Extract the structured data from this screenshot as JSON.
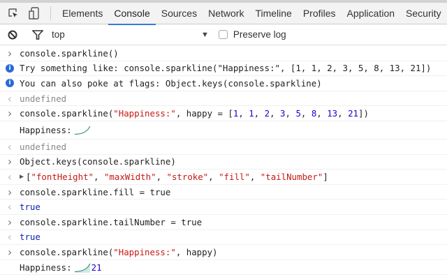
{
  "tabs": [
    {
      "label": "Elements"
    },
    {
      "label": "Console",
      "active": true
    },
    {
      "label": "Sources"
    },
    {
      "label": "Network"
    },
    {
      "label": "Timeline"
    },
    {
      "label": "Profiles"
    },
    {
      "label": "Application"
    },
    {
      "label": "Security"
    }
  ],
  "filter": {
    "context": "top",
    "preserve_log": "Preserve log"
  },
  "colors": {
    "string": "#c41a16",
    "number": "#1c00cf",
    "sparkline": "#3a9a8a",
    "accent": "#3879d9"
  },
  "rows": [
    {
      "kind": "input",
      "segs": [
        {
          "t": "plain",
          "v": "console.sparkline()"
        }
      ]
    },
    {
      "kind": "info",
      "segs": [
        {
          "t": "plain",
          "v": "Try something like: console.sparkline(\"Happiness:\", [1, 1, 2, 3, 5, 8, 13, 21])"
        }
      ]
    },
    {
      "kind": "info",
      "segs": [
        {
          "t": "plain",
          "v": "You can also poke at flags: Object.keys(console.sparkline)"
        }
      ]
    },
    {
      "kind": "result",
      "segs": [
        {
          "t": "gray",
          "v": "undefined"
        }
      ]
    },
    {
      "kind": "input",
      "segs": [
        {
          "t": "plain",
          "v": "console.sparkline("
        },
        {
          "t": "str",
          "v": "\"Happiness:\""
        },
        {
          "t": "plain",
          "v": ", happy = ["
        },
        {
          "t": "num",
          "v": "1"
        },
        {
          "t": "plain",
          "v": ", "
        },
        {
          "t": "num",
          "v": "1"
        },
        {
          "t": "plain",
          "v": ", "
        },
        {
          "t": "num",
          "v": "2"
        },
        {
          "t": "plain",
          "v": ", "
        },
        {
          "t": "num",
          "v": "3"
        },
        {
          "t": "plain",
          "v": ", "
        },
        {
          "t": "num",
          "v": "5"
        },
        {
          "t": "plain",
          "v": ", "
        },
        {
          "t": "num",
          "v": "8"
        },
        {
          "t": "plain",
          "v": ", "
        },
        {
          "t": "num",
          "v": "13"
        },
        {
          "t": "plain",
          "v": ", "
        },
        {
          "t": "num",
          "v": "21"
        },
        {
          "t": "plain",
          "v": "])"
        }
      ]
    },
    {
      "kind": "log",
      "tall": true,
      "segs": [
        {
          "t": "plain",
          "v": "Happiness:"
        }
      ],
      "sparkline": {
        "fill": false,
        "tail": ""
      }
    },
    {
      "kind": "result",
      "segs": [
        {
          "t": "gray",
          "v": "undefined"
        }
      ]
    },
    {
      "kind": "input",
      "segs": [
        {
          "t": "plain",
          "v": "Object.keys(console.sparkline)"
        }
      ]
    },
    {
      "kind": "result",
      "tri": true,
      "segs": [
        {
          "t": "plain",
          "v": "["
        },
        {
          "t": "str",
          "v": "\"fontHeight\""
        },
        {
          "t": "plain",
          "v": ", "
        },
        {
          "t": "str",
          "v": "\"maxWidth\""
        },
        {
          "t": "plain",
          "v": ", "
        },
        {
          "t": "str",
          "v": "\"stroke\""
        },
        {
          "t": "plain",
          "v": ", "
        },
        {
          "t": "str",
          "v": "\"fill\""
        },
        {
          "t": "plain",
          "v": ", "
        },
        {
          "t": "str",
          "v": "\"tailNumber\""
        },
        {
          "t": "plain",
          "v": "]"
        }
      ]
    },
    {
      "kind": "input",
      "segs": [
        {
          "t": "plain",
          "v": "console.sparkline.fill = true"
        }
      ]
    },
    {
      "kind": "result",
      "segs": [
        {
          "t": "kw",
          "v": "true"
        }
      ]
    },
    {
      "kind": "input",
      "segs": [
        {
          "t": "plain",
          "v": "console.sparkline.tailNumber = true"
        }
      ]
    },
    {
      "kind": "result",
      "segs": [
        {
          "t": "kw",
          "v": "true"
        }
      ]
    },
    {
      "kind": "input",
      "segs": [
        {
          "t": "plain",
          "v": "console.sparkline("
        },
        {
          "t": "str",
          "v": "\"Happiness:\""
        },
        {
          "t": "plain",
          "v": ", happy)"
        }
      ]
    },
    {
      "kind": "log",
      "segs": [
        {
          "t": "plain",
          "v": "Happiness:"
        }
      ],
      "sparkline": {
        "fill": true,
        "tail": "21"
      }
    }
  ],
  "sparkline_values": [
    1,
    1,
    2,
    3,
    5,
    8,
    13,
    21
  ]
}
